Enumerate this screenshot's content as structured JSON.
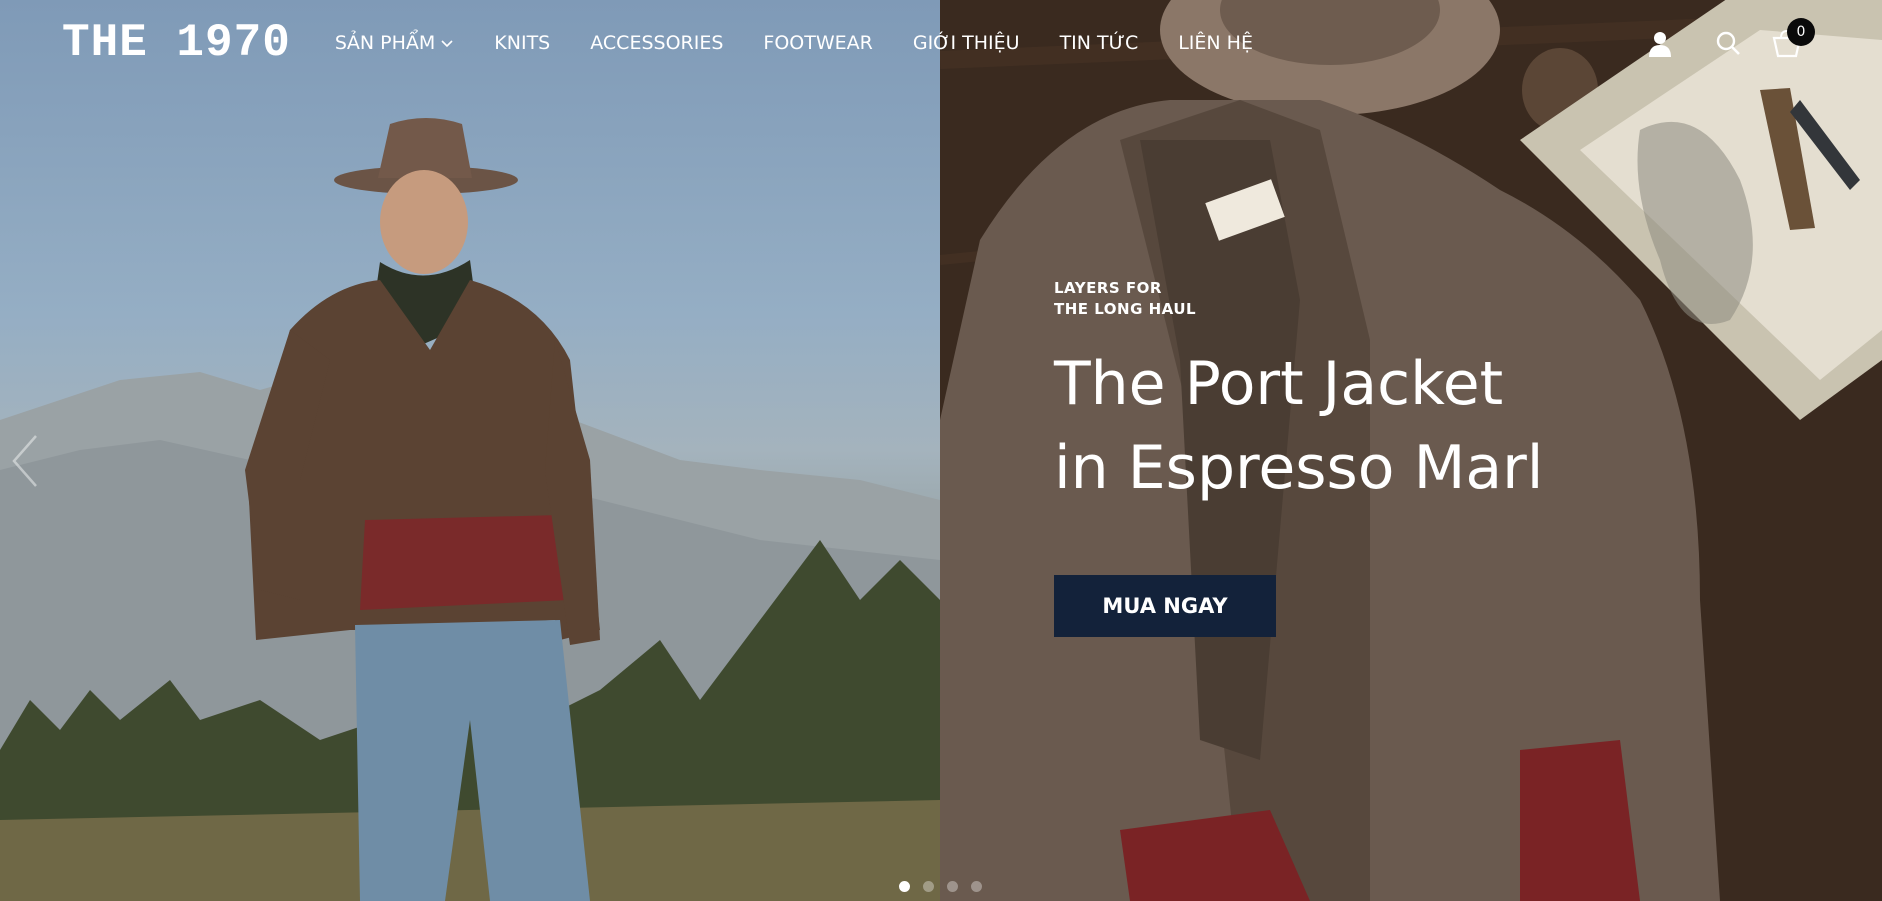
{
  "brand": {
    "logo": "THE 1970"
  },
  "nav": {
    "items": [
      {
        "label": "SẢN PHẨM",
        "has_dropdown": true
      },
      {
        "label": "KNITS"
      },
      {
        "label": "ACCESSORIES"
      },
      {
        "label": "FOOTWEAR"
      },
      {
        "label": "GIỚI THIỆU"
      },
      {
        "label": "TIN TỨC"
      },
      {
        "label": "LIÊN HỆ"
      }
    ]
  },
  "header": {
    "icons": [
      "user-icon",
      "search-icon",
      "cart-icon"
    ],
    "cart_count": "0"
  },
  "hero": {
    "eyebrow_line1": "LAYERS FOR",
    "eyebrow_line2": "THE LONG HAUL",
    "headline_line1": "The Port Jacket",
    "headline_line2": "in Espresso Marl",
    "cta_label": "MUA NGAY",
    "cta_color": "#13223a"
  },
  "slider": {
    "slide_count": 4,
    "active_index": 0
  }
}
